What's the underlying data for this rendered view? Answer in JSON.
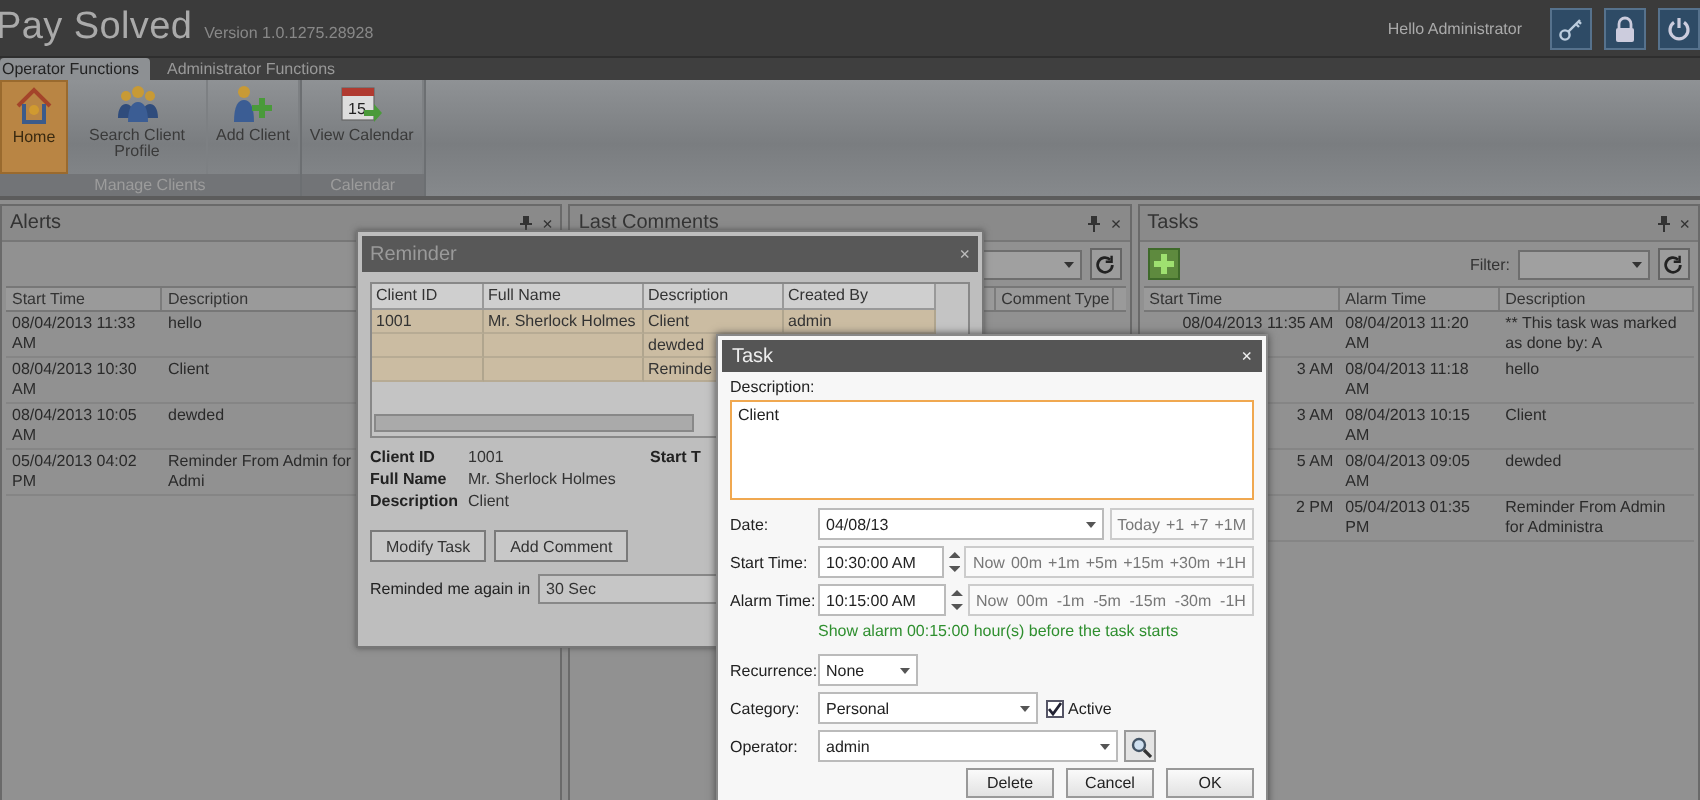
{
  "app": {
    "title": "Pay Solved",
    "version": "Version 1.0.1275.28928",
    "greeting": "Hello Administrator"
  },
  "header_buttons": [
    {
      "kind": "key"
    },
    {
      "kind": "lock"
    },
    {
      "kind": "power"
    }
  ],
  "ribbon_tabs": [
    {
      "label": "Operator Functions",
      "selected": true
    },
    {
      "label": "Administrator Functions",
      "selected": false
    }
  ],
  "ribbon_groups": [
    {
      "label": "Manage Clients",
      "buttons": [
        {
          "label": "Home",
          "kind": "home",
          "selected": true
        },
        {
          "label": "Search Client Profile",
          "kind": "people",
          "selected": false
        },
        {
          "label": "Add Client",
          "kind": "add-person",
          "selected": false
        }
      ]
    },
    {
      "label": "Calendar",
      "buttons": [
        {
          "label": "View Calendar",
          "kind": "calendar",
          "icon_text": "15",
          "selected": false
        }
      ]
    }
  ],
  "alerts": {
    "title": "Alerts",
    "close": "×",
    "columns": [
      "Start Time",
      "Description"
    ],
    "rows": [
      [
        "08/04/2013 11:33 AM",
        "hello"
      ],
      [
        "08/04/2013 10:30 AM",
        "Client"
      ],
      [
        "08/04/2013 10:05 AM",
        "dewded"
      ],
      [
        "05/04/2013 04:02 PM",
        "Reminder From Admin for Admi"
      ]
    ]
  },
  "last_comments": {
    "title": "Last Comments",
    "close": "×",
    "columns": [
      "Comment Type"
    ]
  },
  "tasks": {
    "title": "Tasks",
    "close": "×",
    "filter_label": "Filter:",
    "columns": [
      "Start Time",
      "Alarm Time",
      "Description"
    ],
    "rows": [
      [
        "08/04/2013 11:35 AM",
        "08/04/2013 11:20 AM",
        "** This task was marked as done by: A"
      ],
      [
        "3 AM",
        "08/04/2013 11:18 AM",
        "hello"
      ],
      [
        "3 AM",
        "08/04/2013 10:15 AM",
        "Client"
      ],
      [
        "5 AM",
        "08/04/2013 09:05 AM",
        "dewded"
      ],
      [
        "2 PM",
        "05/04/2013 01:35 PM",
        "Reminder From Admin for Administra"
      ]
    ]
  },
  "reminder": {
    "title": "Reminder",
    "close": "×",
    "columns": [
      "Client ID",
      "Full Name",
      "Description",
      "Created By"
    ],
    "rows": [
      {
        "client_id": "1001",
        "full_name": "Mr. Sherlock Holmes",
        "description": "Client",
        "created_by": "admin"
      },
      {
        "description": "dewded"
      },
      {
        "description": "Reminde"
      }
    ],
    "details": [
      {
        "label": "Client ID",
        "value": "1001"
      },
      {
        "label": "Full Name",
        "value": "Mr. Sherlock Holmes"
      },
      {
        "label": "Description",
        "value": "Client"
      }
    ],
    "start_label": "Start T",
    "buttons": [
      "Modify Task",
      "Add Comment"
    ],
    "snooze_label": "Reminded me again in",
    "snooze_value": "30 Sec"
  },
  "task": {
    "title": "Task",
    "close": "×",
    "description_label": "Description:",
    "description": "Client",
    "fields": [
      {
        "kind": "date",
        "label": "Date:",
        "value": "04/08/13",
        "quick": [
          "Today",
          "+1",
          "+7",
          "+1M"
        ]
      },
      {
        "kind": "time",
        "label": "Start Time:",
        "value": "10:30:00 AM",
        "quick": [
          "Now",
          "00m",
          "+1m",
          "+5m",
          "+15m",
          "+30m",
          "+1H"
        ]
      },
      {
        "kind": "time",
        "label": "Alarm Time:",
        "value": "10:15:00 AM",
        "quick": [
          "Now",
          "00m",
          "-1m",
          "-5m",
          "-15m",
          "-30m",
          "-1H"
        ]
      }
    ],
    "note": "Show alarm 00:15:00 hour(s) before the task starts",
    "recurrence": {
      "label": "Recurrence:",
      "value": "None"
    },
    "category": {
      "label": "Category:",
      "value": "Personal"
    },
    "active": {
      "label": "Active",
      "checked": true
    },
    "operator": {
      "label": "Operator:",
      "value": "admin"
    },
    "buttons": [
      "Delete",
      "Cancel",
      "OK"
    ]
  }
}
